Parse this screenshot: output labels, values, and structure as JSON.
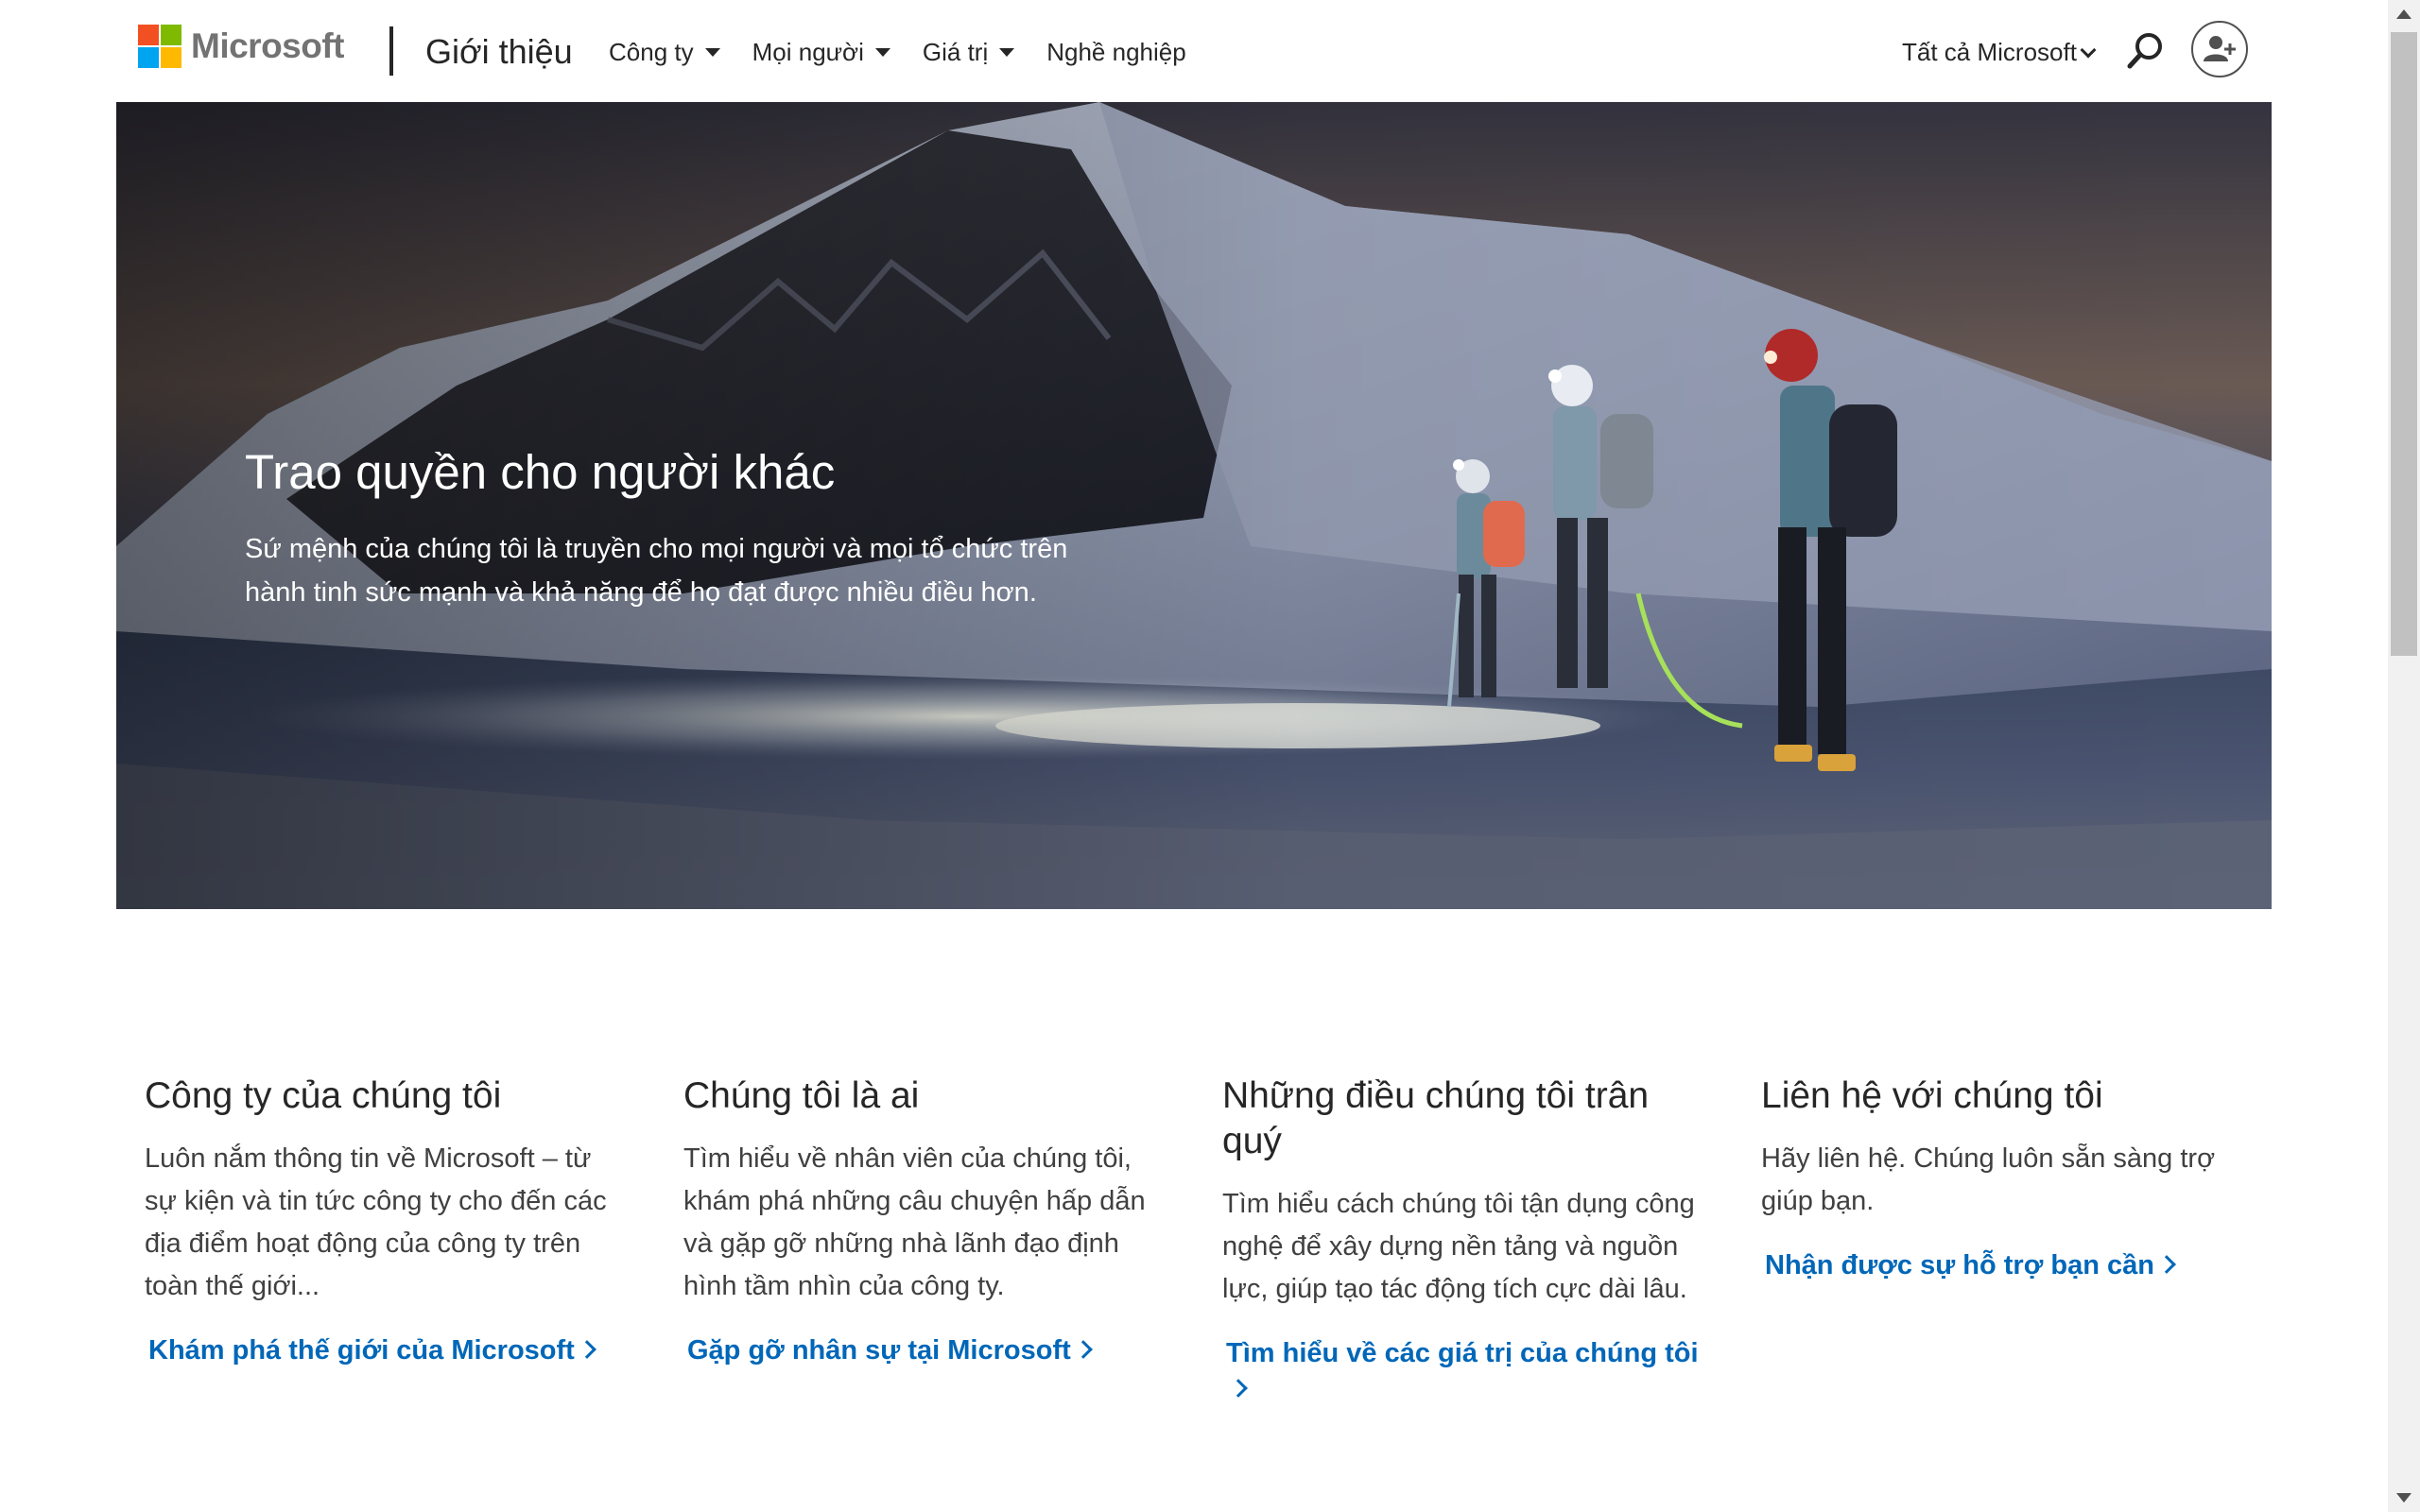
{
  "header": {
    "logo_text": "Microsoft",
    "site_title": "Giới thiệu",
    "nav": [
      {
        "label": "Công ty",
        "has_dropdown": true
      },
      {
        "label": "Mọi người",
        "has_dropdown": true
      },
      {
        "label": "Giá trị",
        "has_dropdown": true
      },
      {
        "label": "Nghề nghiệp",
        "has_dropdown": false
      }
    ],
    "all_microsoft": "Tất cả Microsoft",
    "search_icon": "search-icon",
    "account_icon": "add-user-icon"
  },
  "hero": {
    "heading": "Trao quyền cho người khác",
    "description": "Sứ mệnh của chúng tôi là truyền cho mọi người và mọi tổ chức trên hành tinh sức mạnh và khả năng để họ đạt được nhiều điều hơn."
  },
  "cards": [
    {
      "title": "Công ty của chúng tôi",
      "body": "Luôn nắm thông tin về Microsoft – từ sự kiện và tin tức công ty cho đến các địa điểm hoạt động của công ty trên toàn thế giới...",
      "link": "Khám phá thế giới của Microsoft"
    },
    {
      "title": "Chúng tôi là ai",
      "body": "Tìm hiểu về nhân viên của chúng tôi, khám phá những câu chuyện hấp dẫn và gặp gỡ những nhà lãnh đạo định hình tầm nhìn của công ty.",
      "link": "Gặp gỡ nhân sự tại Microsoft"
    },
    {
      "title": "Những điều chúng tôi trân quý",
      "body": "Tìm hiểu cách chúng tôi tận dụng công nghệ để xây dựng nền tảng và nguồn lực, giúp tạo tác động tích cực dài lâu.",
      "link": "Tìm hiểu về các giá trị của chúng tôi"
    },
    {
      "title": "Liên hệ với chúng tôi",
      "body": "Hãy liên hệ. Chúng luôn sẵn sàng trợ giúp bạn.",
      "link": "Nhận được sự hỗ trợ bạn cần"
    }
  ],
  "colors": {
    "logo_red": "#f25022",
    "logo_green": "#7fba00",
    "logo_blue": "#00a4ef",
    "logo_yellow": "#ffb900",
    "link": "#0067b8",
    "text": "#262626"
  }
}
